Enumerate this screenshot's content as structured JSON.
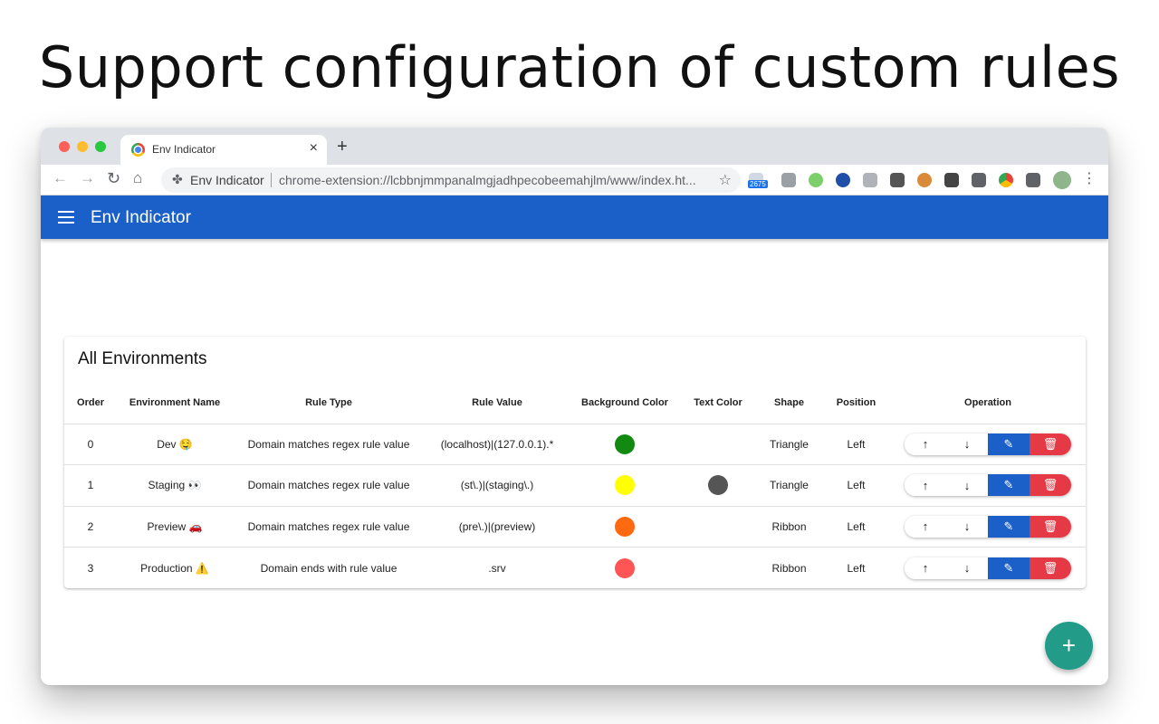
{
  "headline": "Support configuration of custom rules",
  "browser": {
    "tab_title": "Env Indicator",
    "tab_close": "×",
    "new_tab": "+",
    "omnibox_name": "Env Indicator",
    "omnibox_url": "chrome-extension://lcbbnjmmpanalmgjadhpecobeemahjlm/www/index.ht...",
    "extension_badge": "2675",
    "extension_icons": [
      "mail-icon",
      "green-circle-icon",
      "at-icon",
      "shield-icon",
      "ublock-icon",
      "cookie-icon",
      "tabs-icon",
      "vue-icon",
      "chrome-icon",
      "puzzle-icon",
      "avatar"
    ]
  },
  "app": {
    "title": "Env Indicator"
  },
  "card": {
    "title": "All Environments",
    "columns": [
      "Order",
      "Environment Name",
      "Rule Type",
      "Rule Value",
      "Background Color",
      "Text Color",
      "Shape",
      "Position",
      "Operation"
    ],
    "rows": [
      {
        "order": "0",
        "name": "Dev 🤤",
        "rule_type": "Domain matches regex rule value",
        "rule_value": "(localhost)|(127.0.0.1).*",
        "bg_color": "#128a12",
        "text_color": "",
        "shape": "Triangle",
        "position": "Left"
      },
      {
        "order": "1",
        "name": "Staging 👀",
        "rule_type": "Domain matches regex rule value",
        "rule_value": "(st\\.)|(staging\\.)",
        "bg_color": "#ffff00",
        "text_color": "#555555",
        "shape": "Triangle",
        "position": "Left"
      },
      {
        "order": "2",
        "name": "Preview 🚗",
        "rule_type": "Domain matches regex rule value",
        "rule_value": "(pre\\.)|(preview)",
        "bg_color": "#ff6a10",
        "text_color": "",
        "shape": "Ribbon",
        "position": "Left"
      },
      {
        "order": "3",
        "name": "Production ⚠️",
        "rule_type": "Domain ends with rule value",
        "rule_value": ".srv",
        "bg_color": "#ff5555",
        "text_color": "",
        "shape": "Ribbon",
        "position": "Left"
      }
    ]
  },
  "operation_icons": {
    "up": "↑",
    "down": "↓",
    "edit": "✎",
    "delete": "🗑"
  },
  "colors": {
    "app_bar": "#1a60c8",
    "edit": "#1a60c8",
    "delete": "#e53946",
    "fab": "#229b89"
  },
  "fab_label": "+"
}
